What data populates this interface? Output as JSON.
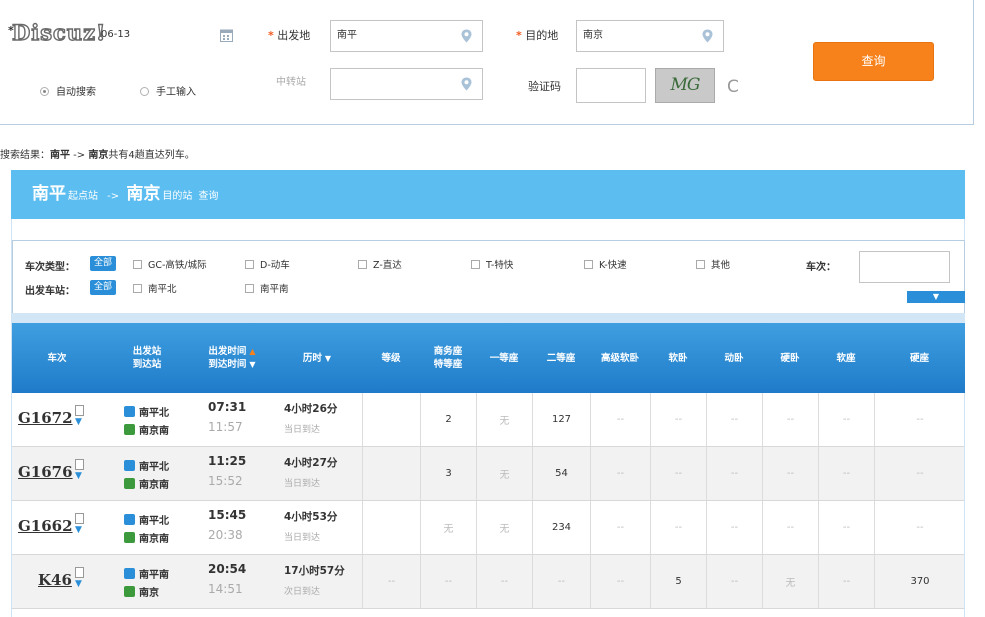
{
  "form": {
    "logo_text": "Discuz!",
    "date_value": "06-13",
    "from_label": "出发地",
    "from_value": "南平",
    "to_label": "目的地",
    "to_value": "南京",
    "via_placeholder": "中转站",
    "captcha_label": "验证码",
    "captcha_value": "",
    "captcha_image_text": "MG",
    "refresh_glyph": "C",
    "query_button": "查询",
    "radio_auto": "自动搜索",
    "radio_manual": "手工输入",
    "required_mark": "*"
  },
  "summary": {
    "prefix": "搜索结果：",
    "from": "南平",
    "arrow": " -> ",
    "to": "南京",
    "suffix": "共有4趟直达列车。"
  },
  "banner": {
    "from": "南平",
    "from_sub": "起点站",
    "arrow": " -> ",
    "to": "南京",
    "to_sub": "目的站",
    "action": "查询"
  },
  "filter": {
    "type_label": "车次类型：",
    "station_label": "出发车站：",
    "all": "全部",
    "types": [
      "GC-高铁/城际",
      "D-动车",
      "Z-直达",
      "T-特快",
      "K-快速",
      "其他"
    ],
    "stations": [
      "南平北",
      "南平南"
    ],
    "train_no_label": "车次：",
    "train_no_value": "",
    "collapse_glyph": "▼"
  },
  "table": {
    "headers": {
      "train": "车次",
      "stations_1": "出发站",
      "stations_2": "到达站",
      "time_1": "出发时间",
      "time_1_arrow": "▲",
      "time_2": "到达时间",
      "time_2_arrow": "▼",
      "duration": "历时",
      "duration_arrow": "▼",
      "special": "等级",
      "business_1": "商务座",
      "business_2": "特等座",
      "first": "一等座",
      "second": "二等座",
      "soft_sleeper_adv": "高级软卧",
      "soft_sleeper": "软卧",
      "moving_sleeper": "动卧",
      "hard_sleeper": "硬卧",
      "soft_seat": "软座",
      "hard_seat": "硬座"
    },
    "rows": [
      {
        "train": "G1672",
        "from": "南平北",
        "to": "南京南",
        "dep": "07:31",
        "arr": "11:57",
        "duration": "4小时26分",
        "arrive_note": "当日到达",
        "seats": [
          "",
          "2",
          "无",
          "127",
          "--",
          "--",
          "--",
          "--",
          "--",
          "--"
        ]
      },
      {
        "train": "G1676",
        "from": "南平北",
        "to": "南京南",
        "dep": "11:25",
        "arr": "15:52",
        "duration": "4小时27分",
        "arrive_note": "当日到达",
        "seats": [
          "",
          "3",
          "无",
          "54",
          "--",
          "--",
          "--",
          "--",
          "--",
          "--"
        ]
      },
      {
        "train": "G1662",
        "from": "南平北",
        "to": "南京南",
        "dep": "15:45",
        "arr": "20:38",
        "duration": "4小时53分",
        "arrive_note": "当日到达",
        "seats": [
          "",
          "无",
          "无",
          "234",
          "--",
          "--",
          "--",
          "--",
          "--",
          "--"
        ]
      },
      {
        "train": "K46",
        "from": "南平南",
        "to": "南京",
        "dep": "20:54",
        "arr": "14:51",
        "duration": "17小时57分",
        "arrive_note": "次日到达",
        "seats": [
          "--",
          "--",
          "--",
          "--",
          "--",
          "5",
          "--",
          "无",
          "--",
          "370"
        ]
      }
    ]
  },
  "colors": {
    "accent_orange": "#f7821b",
    "banner_blue": "#5bbdf0",
    "header_blue": "#1f7bc9",
    "tag_blue": "#2a8fd8"
  }
}
